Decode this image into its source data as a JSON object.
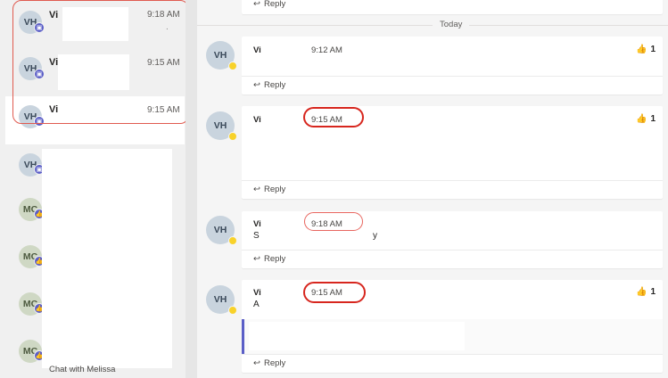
{
  "left_pane": {
    "conversations": [
      {
        "initials": "VH",
        "name": "Vi",
        "time": "9:18 AM",
        "preview": ".",
        "selected": false
      },
      {
        "initials": "VH",
        "name": "Vi",
        "time": "9:15 AM",
        "preview": "",
        "selected": false
      },
      {
        "initials": "VH",
        "name": "Vi",
        "time": "9:15 AM",
        "preview": "",
        "selected": true
      },
      {
        "initials": "VH",
        "name": "",
        "time": "",
        "preview": "",
        "selected": false
      },
      {
        "initials": "MC",
        "name": "",
        "time": "",
        "preview": "",
        "selected": false
      },
      {
        "initials": "MC",
        "name": "",
        "time": "",
        "preview": "",
        "selected": false
      },
      {
        "initials": "MC",
        "name": "",
        "time": "",
        "preview": "",
        "selected": false
      },
      {
        "initials": "MC",
        "name": "",
        "time": "",
        "preview": "",
        "selected": false
      }
    ],
    "footer_text": "Chat with Melissa",
    "badge_colors": {
      "chat": "#5b5fc7",
      "like": "#5b5fc7"
    }
  },
  "right_pane": {
    "top_reply_label": "Reply",
    "date_separator": "Today",
    "messages": [
      {
        "avatar": "VH",
        "sender": "Vi",
        "time": "9:12 AM",
        "reaction_icon": "thumbs-up-icon",
        "reaction_count": "1",
        "reply_label": "Reply"
      },
      {
        "avatar": "VH",
        "sender": "Vi",
        "time": "9:15 AM",
        "reaction_icon": "thumbs-up-icon",
        "reaction_count": "1",
        "reply_label": "Reply"
      },
      {
        "avatar": "VH",
        "sender": "Vi",
        "time": "9:18 AM",
        "body_fragment_start": "S",
        "body_fragment_end": "y",
        "reply_label": "Reply"
      },
      {
        "avatar": "VH",
        "sender": "Vi",
        "time": "9:15 AM",
        "body_fragment_start": "A",
        "reaction_icon": "thumbs-up-icon",
        "reaction_count": "1",
        "reply_label": "Reply"
      }
    ]
  },
  "colors": {
    "highlight_ring": "#d7261e",
    "selection_box": "#e05a4f",
    "presence_away": "#f8d22a",
    "quote_bar": "#5b5fc7"
  }
}
